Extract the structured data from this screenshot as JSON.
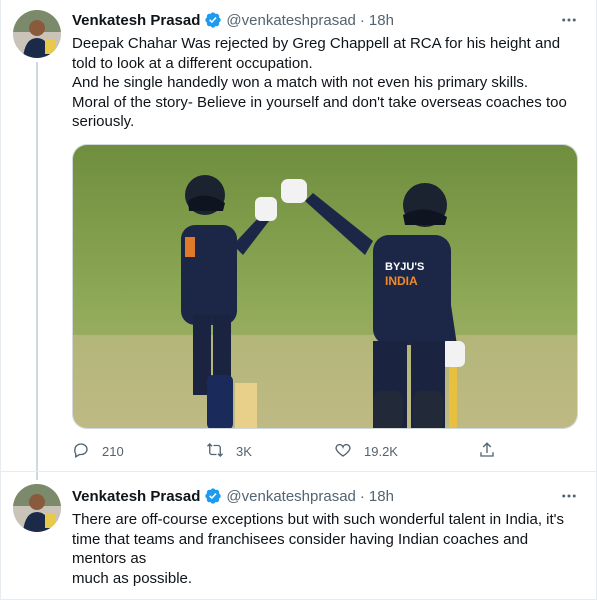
{
  "tweets": [
    {
      "author": {
        "name": "Venkatesh Prasad",
        "handle": "@venkateshprasad",
        "verified": true
      },
      "separator": "·",
      "time": "18h",
      "lines": [
        "Deepak Chahar Was rejected by Greg Chappell at RCA for his height and",
        "told to look at a different occupation.",
        "And he single handedly won a match with not even his primary skills.",
        "Moral of the story- Believe in yourself and don't take overseas coaches too",
        "seriously."
      ],
      "media": {
        "jersey_text": "BYJU'S INDIA"
      },
      "stats": {
        "replies": "210",
        "retweets": "3K",
        "likes": "19.2K"
      }
    },
    {
      "author": {
        "name": "Venkatesh Prasad",
        "handle": "@venkateshprasad",
        "verified": true
      },
      "separator": "·",
      "time": "18h",
      "lines": [
        "There are off-course exceptions but with such wonderful talent in India, it's",
        "time that teams and franchisees consider having  Indian coaches and",
        "mentors as",
        "much as possible."
      ]
    }
  ],
  "colors": {
    "brand_blue": "#1d9bf0",
    "text": "#0f1419",
    "muted": "#536471",
    "border": "#e6ecf0"
  },
  "icons": {
    "verified": "verified-badge-icon",
    "more": "more-options-icon",
    "reply": "reply-icon",
    "retweet": "retweet-icon",
    "like": "heart-icon",
    "share": "share-icon"
  }
}
